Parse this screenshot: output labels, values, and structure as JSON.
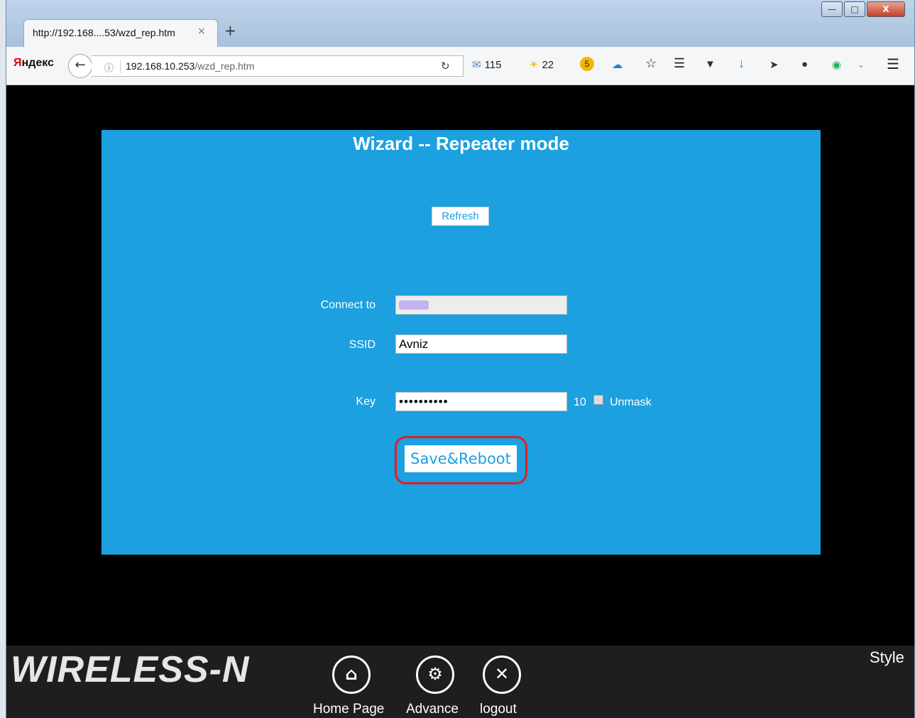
{
  "browser": {
    "tab_title": "http://192.168....53/wzd_rep.htm",
    "tab_close": "×",
    "new_tab": "+",
    "window_controls": {
      "minimize": "—",
      "maximize": "□",
      "close": "X"
    },
    "brand_first": "Я",
    "brand_rest": "ндекс",
    "url_host": "192.168.10.253",
    "url_path": "/wzd_rep.htm",
    "mail_count": "115",
    "weather_temp": "22",
    "badge_number": "5",
    "icons": [
      "back-arrow-icon",
      "info-icon",
      "reload-icon",
      "mail-icon",
      "sun-icon",
      "cloud-icon",
      "star-icon",
      "reading-list-icon",
      "pocket-icon",
      "download-icon",
      "send-icon",
      "chat-icon",
      "shield-icon",
      "chevron-down-icon",
      "menu-icon"
    ]
  },
  "page": {
    "title": "Wizard -- Repeater mode",
    "refresh_label": "Refresh",
    "connect_to_label": "Connect to",
    "ssid_label": "SSID",
    "ssid_value": "Avniz",
    "key_label": "Key",
    "key_value": "••••••••••",
    "key_length": "10",
    "unmask_label": "Unmask",
    "unmask_checked": false,
    "save_label": "Save&Reboot"
  },
  "footer": {
    "logo": "WIRELESS-N",
    "style_label": "Style",
    "nav": [
      {
        "label": "Home Page",
        "icon": "home-icon"
      },
      {
        "label": "Advance",
        "icon": "gear-icon"
      },
      {
        "label": "logout",
        "icon": "close-icon"
      }
    ]
  },
  "colors": {
    "panel": "#1ca0e0",
    "highlight": "#e02020",
    "footer": "#1e1e1e"
  }
}
